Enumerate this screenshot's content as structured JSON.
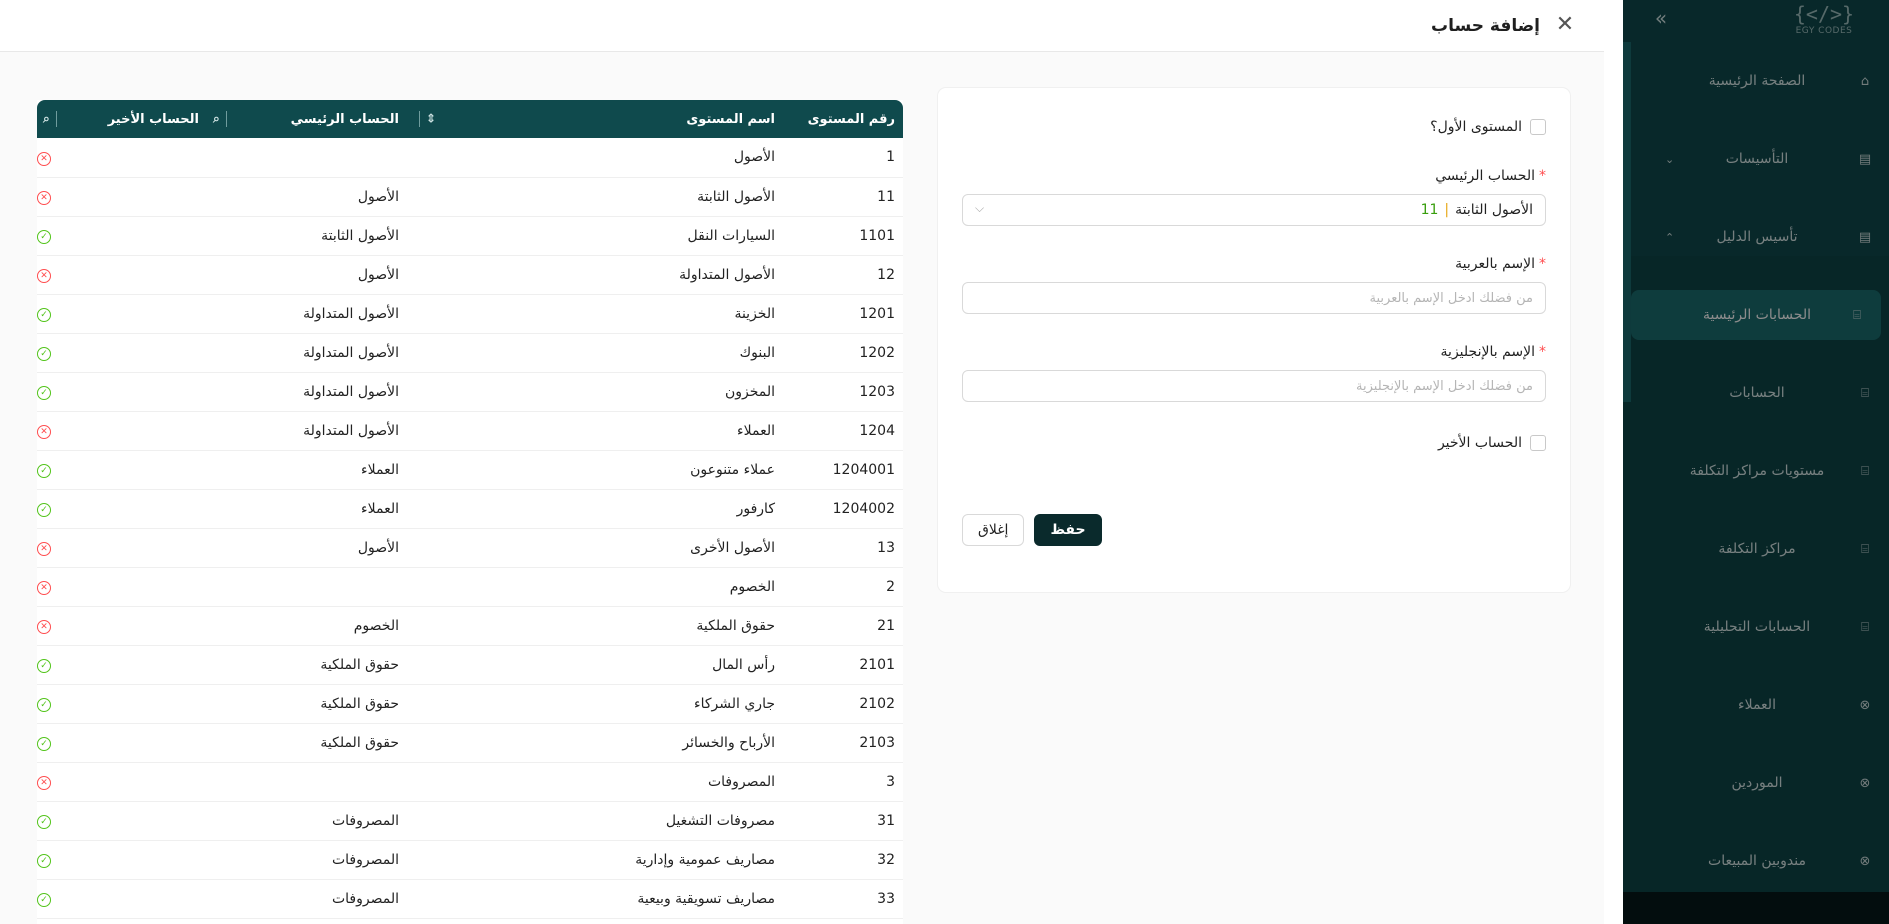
{
  "sidebar": {
    "logo_text": "EGY CODES",
    "items": [
      {
        "label": "الصفحة الرئيسية",
        "icon": "home-icon"
      },
      {
        "label": "التأسيسات",
        "icon": "building-icon",
        "chevron": "down"
      },
      {
        "label": "تأسيس الدليل",
        "icon": "building-icon",
        "chevron": "up"
      },
      {
        "label": "الحسابات الرئيسية",
        "icon": "bank-icon",
        "active": true
      },
      {
        "label": "الحسابات",
        "icon": "bank-icon"
      },
      {
        "label": "مستويات مراكز التكلفة",
        "icon": "bank-icon"
      },
      {
        "label": "مراكز التكلفة",
        "icon": "bank-icon"
      },
      {
        "label": "الحسابات التحليلية",
        "icon": "bank-icon"
      },
      {
        "label": "العملاء",
        "icon": "close-circle-icon"
      },
      {
        "label": "الموردين",
        "icon": "close-circle-icon"
      },
      {
        "label": "مندوبين المبيعات",
        "icon": "close-circle-icon"
      }
    ]
  },
  "modal": {
    "title": "إضافة حساب"
  },
  "form": {
    "first_level_label": "المستوى الأول؟",
    "parent_label": "الحساب الرئيسي",
    "parent_value_name": "الأصول الثابتة",
    "parent_value_sep": "|",
    "parent_value_code": "11",
    "name_ar_label": "الإسم بالعربية",
    "name_ar_placeholder": "من فضلك ادخل الإسم بالعربية",
    "name_en_label": "الإسم بالإنجليزية",
    "name_en_placeholder": "من فضلك ادخل الإسم بالإنجليزية",
    "last_account_label": "الحساب الأخير",
    "save_label": "حفظ",
    "close_label": "إغلاق"
  },
  "table": {
    "headers": {
      "level_number": "رقم المستوى",
      "level_name": "اسم المستوى",
      "parent_account": "الحساب الرئيسي",
      "last_account": "الحساب الأخير"
    },
    "colors": {
      "ok": "#52c41a",
      "no": "#ff4d4f",
      "header": "#0f4a4d"
    },
    "rows": [
      {
        "num": "1",
        "name": "الأصول",
        "parent": "",
        "last": false
      },
      {
        "num": "11",
        "name": "الأصول الثابتة",
        "parent": "الأصول",
        "last": false
      },
      {
        "num": "1101",
        "name": "السيارات النقل",
        "parent": "الأصول الثابتة",
        "last": true
      },
      {
        "num": "12",
        "name": "الأصول المتداولة",
        "parent": "الأصول",
        "last": false
      },
      {
        "num": "1201",
        "name": "الخزينة",
        "parent": "الأصول المتداولة",
        "last": true
      },
      {
        "num": "1202",
        "name": "البنوك",
        "parent": "الأصول المتداولة",
        "last": true
      },
      {
        "num": "1203",
        "name": "المخزون",
        "parent": "الأصول المتداولة",
        "last": true
      },
      {
        "num": "1204",
        "name": "العملاء",
        "parent": "الأصول المتداولة",
        "last": false
      },
      {
        "num": "1204001",
        "name": "عملاء متنوعون",
        "parent": "العملاء",
        "last": true
      },
      {
        "num": "1204002",
        "name": "كارفور",
        "parent": "العملاء",
        "last": true
      },
      {
        "num": "13",
        "name": "الأصول الأخرى",
        "parent": "الأصول",
        "last": false
      },
      {
        "num": "2",
        "name": "الخصوم",
        "parent": "",
        "last": false
      },
      {
        "num": "21",
        "name": "حقوق الملكية",
        "parent": "الخصوم",
        "last": false
      },
      {
        "num": "2101",
        "name": "رأس المال",
        "parent": "حقوق الملكية",
        "last": true
      },
      {
        "num": "2102",
        "name": "جاري الشركاء",
        "parent": "حقوق الملكية",
        "last": true
      },
      {
        "num": "2103",
        "name": "الأرباح والخسائر",
        "parent": "حقوق الملكية",
        "last": true
      },
      {
        "num": "3",
        "name": "المصروفات",
        "parent": "",
        "last": false
      },
      {
        "num": "31",
        "name": "مصروفات التشغيل",
        "parent": "المصروفات",
        "last": true
      },
      {
        "num": "32",
        "name": "مصاريف عمومية وإدارية",
        "parent": "المصروفات",
        "last": true
      },
      {
        "num": "33",
        "name": "مصاريف تسويقية وبيعية",
        "parent": "المصروفات",
        "last": true
      }
    ]
  }
}
